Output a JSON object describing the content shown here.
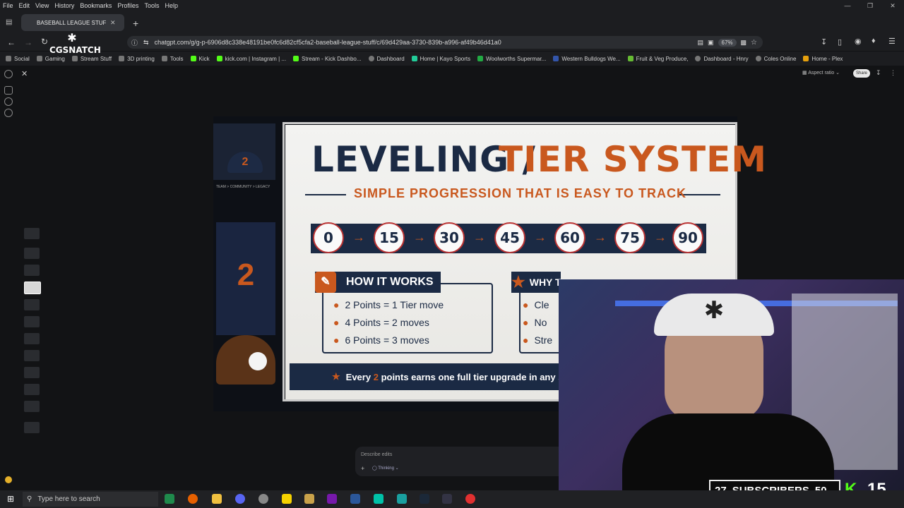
{
  "menu": [
    "File",
    "Edit",
    "View",
    "History",
    "Bookmarks",
    "Profiles",
    "Tools",
    "Help"
  ],
  "tab": {
    "title": "BASEBALL LEAGUE STUFF - "
  },
  "address": {
    "url": "chatgpt.com/g/g-p-6906d8c338e48191be0fc6d82cf5cfa2-baseball-league-stuff/c/69d429aa-3730-839b-a996-af49b46d41a0",
    "zoom": "67%"
  },
  "bookmarks": [
    "Social",
    "Gaming",
    "Stream Stuff",
    "3D printing",
    "Tools",
    "Kick",
    "kick.com | Instagram | ...",
    "Stream - Kick Dashbo...",
    "Dashboard",
    "Home | Kayo Sports",
    "Woolworths Supermar...",
    "Western Bulldogs We...",
    "Fruit & Veg Produce,",
    "Dashboard - Hnry",
    "Coles Online",
    "Home - Plex"
  ],
  "overlay_logo": "CGSNATCH",
  "toolbar": {
    "aspect": "Aspect ratio",
    "share": "Share"
  },
  "graphic": {
    "title_a": "LEVELING / ",
    "title_b": "TIER SYSTEM",
    "subtitle": "SIMPLE PROGRESSION THAT IS EASY TO TRACK",
    "tiers": [
      "0",
      "15",
      "30",
      "45",
      "60",
      "75",
      "90"
    ],
    "how_title": "HOW IT WORKS",
    "how_items": [
      "2 Points = 1 Tier move",
      "4 Points = 2 moves",
      "6 Points = 3 moves"
    ],
    "why_title": "WHY THIS IS BETTER",
    "why_items": [
      "Cle",
      "No",
      "Stre"
    ],
    "banner_pre": "Every ",
    "banner_num": "2",
    "banner_post": " points earns one full tier upgrade in any st",
    "locker_tag": "TEAM > COMMUNITY > LEGACY",
    "jersey_number": "2"
  },
  "prompt": {
    "placeholder": "Describe edits",
    "mode": "Thinking"
  },
  "stream": {
    "subs_count": "27",
    "subs_label": "SUBSCRIBERS",
    "subs_goal": "50",
    "kick_count": "15"
  },
  "taskbar": {
    "search": "Type here to search"
  }
}
